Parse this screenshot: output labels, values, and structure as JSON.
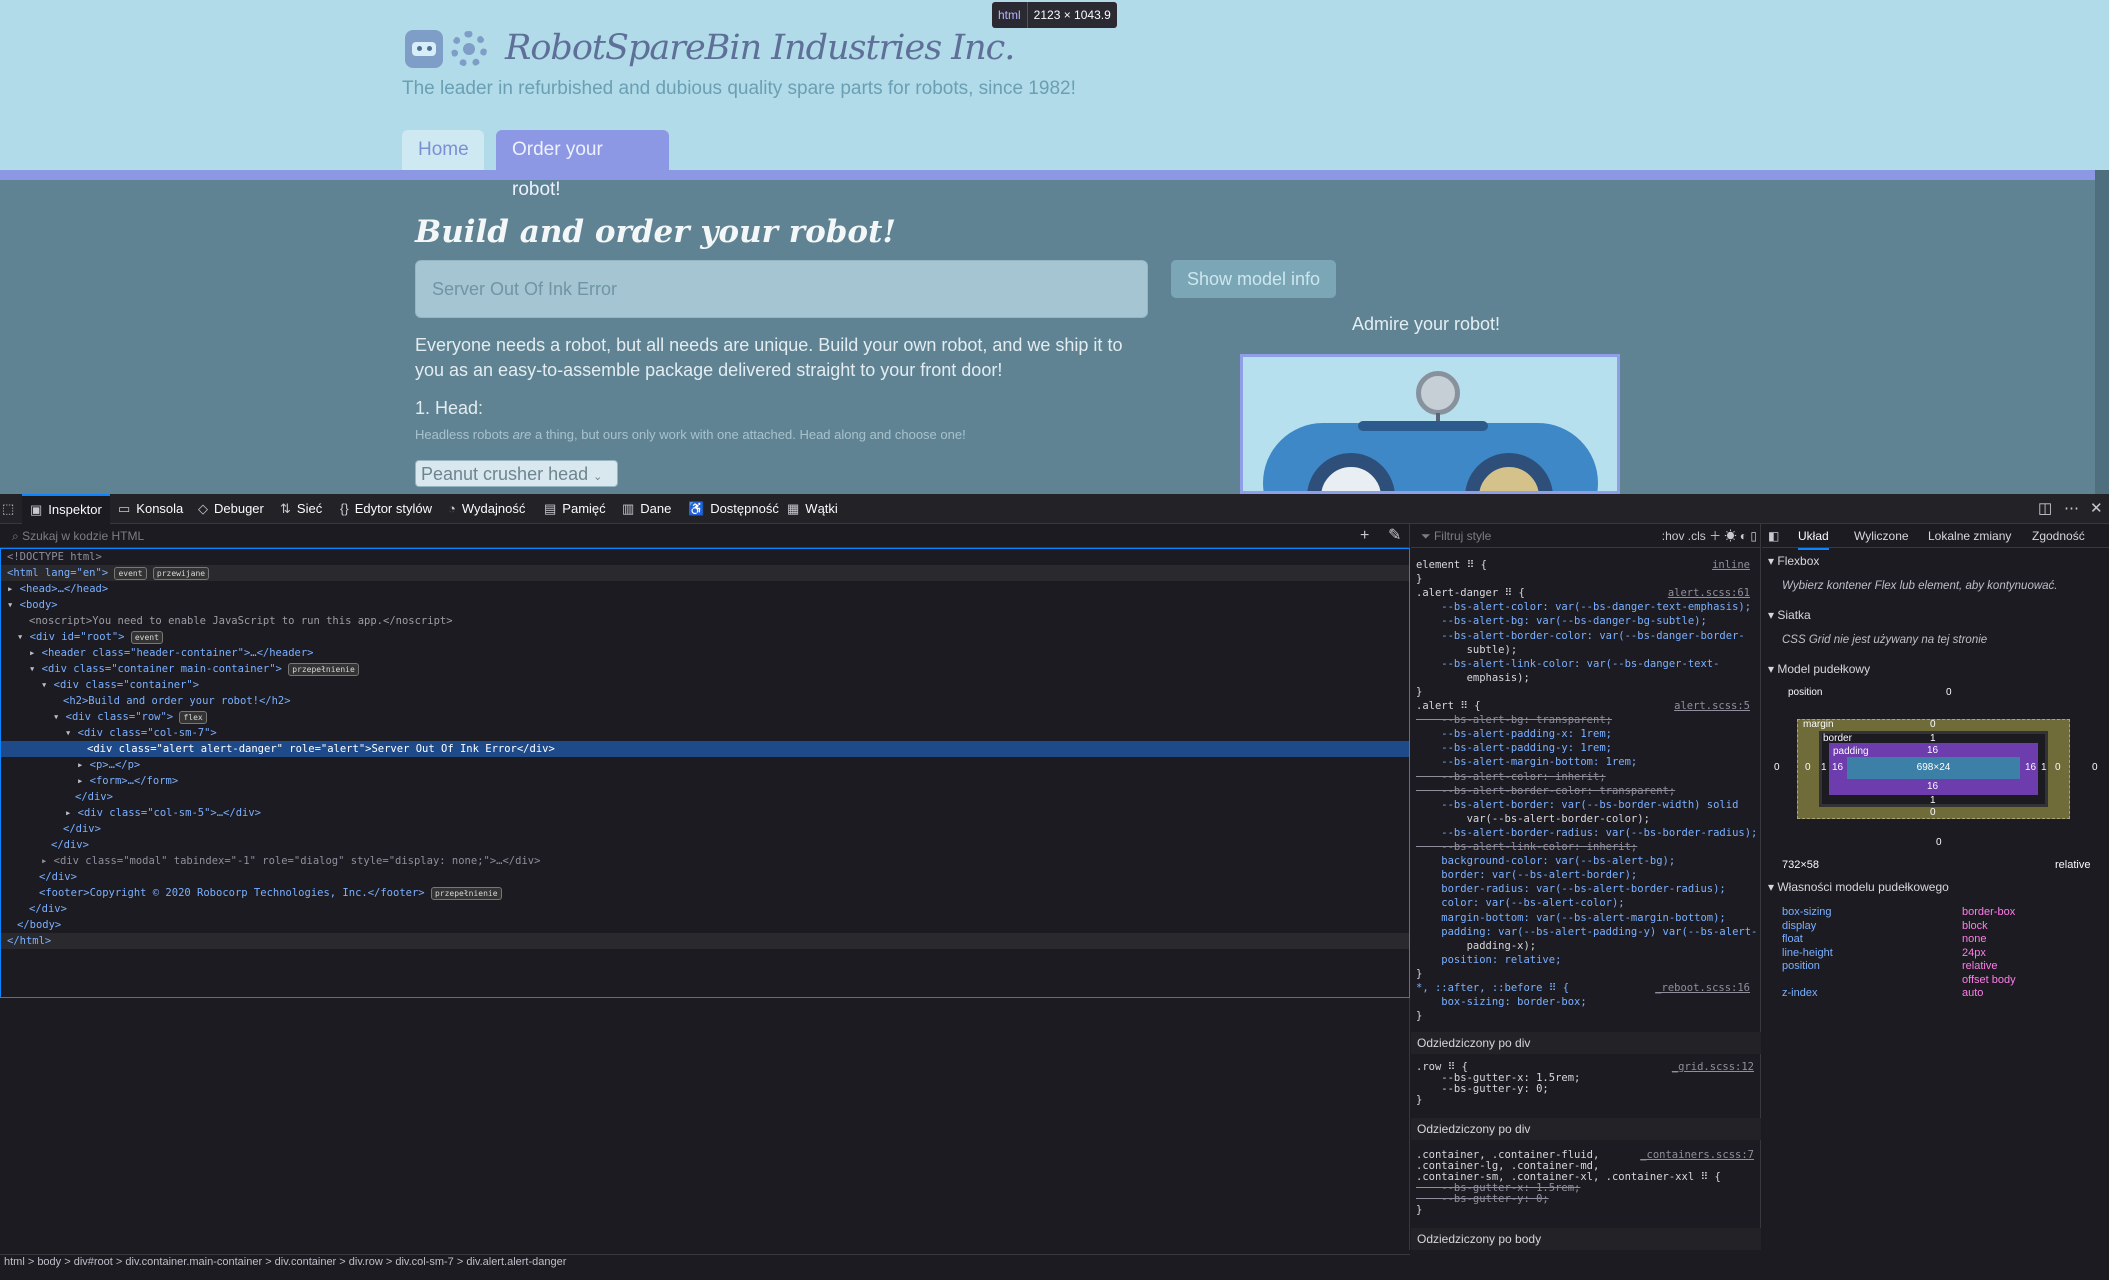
{
  "page": {
    "site_title": "RobotSpareBin Industries Inc.",
    "tagline": "The leader in refurbished and dubious quality spare parts for robots, since 1982!",
    "nav": [
      {
        "label": "Home"
      },
      {
        "label": "Order your robot!"
      }
    ],
    "main_title": "Build and order your robot!",
    "alert_text": "Server Out Of Ink Error",
    "show_model_label": "Show model info",
    "admire_text": "Admire your robot!",
    "intro_text": "Everyone needs a robot, but all needs are unique. Build your own robot, and we ship it to you as an easy-to-assemble package delivered straight to your front door!",
    "head_label": "1. Head:",
    "head_hint_a": "Headless robots ",
    "head_hint_em": "are",
    "head_hint_b": " a thing, but ours only work with one attached. Head along and choose one!",
    "head_select_value": "Peanut crusher head",
    "tooltip_tag": "html",
    "tooltip_size": "2123 × 1043.9"
  },
  "devtools": {
    "tabs": [
      "Inspektor",
      "Konsola",
      "Debuger",
      "Sieć",
      "Edytor stylów",
      "Wydajność",
      "Pamięć",
      "Dane",
      "Dostępność",
      "Wątki"
    ],
    "search_placeholder": "Szukaj w kodzie HTML",
    "tree": [
      "<!DOCTYPE html>",
      "<html lang=\"en\">",
      "<head>…</head>",
      "<body>",
      "<noscript>You need to enable JavaScript to run this app.</noscript>",
      "<div id=\"root\">",
      "<header class=\"header-container\">…</header>",
      "<div class=\"container main-container\">",
      "<div class=\"container\">",
      "<h2>Build and order your robot!</h2>",
      "<div class=\"row\">",
      "<div class=\"col-sm-7\">",
      "<div class=\"alert alert-danger\" role=\"alert\">Server Out Of Ink Error</div>",
      "<p>…</p>",
      "<form>…</form>",
      "</div>",
      "<div class=\"col-sm-5\">…</div>",
      "</div>",
      "</div>",
      "<div class=\"modal\" tabindex=\"-1\" role=\"dialog\" style=\"display: none;\">…</div>",
      "</div>",
      "<footer>Copyright © 2020 Robocorp Technologies, Inc.</footer>",
      "</div>",
      "</body>",
      "</html>"
    ],
    "badges": {
      "event": "event",
      "scroll": "przewijane",
      "flex": "flex",
      "overflow": "przepełnienie"
    },
    "styles_filter": "Filtruj style",
    "styles_tools": ":hov  .cls",
    "rules": [
      {
        "text": "element ⠿ {",
        "src": "inline"
      },
      {
        "text": "}",
        "src": ""
      },
      {
        "text": ".alert-danger ⠿ {",
        "src": "alert.scss:61"
      },
      {
        "text": "    --bs-alert-color: var(--bs-danger-text-emphasis);",
        "src": ""
      },
      {
        "text": "    --bs-alert-bg: var(--bs-danger-bg-subtle);",
        "src": ""
      },
      {
        "text": "    --bs-alert-border-color: var(--bs-danger-border-",
        "src": ""
      },
      {
        "text": "        subtle);",
        "src": ""
      },
      {
        "text": "    --bs-alert-link-color: var(--bs-danger-text-",
        "src": ""
      },
      {
        "text": "        emphasis);",
        "src": ""
      },
      {
        "text": "}",
        "src": ""
      },
      {
        "text": ".alert ⠿ {",
        "src": "alert.scss:5"
      },
      {
        "text": "    --bs-alert-bg: transparent;",
        "src": "",
        "strike": true
      },
      {
        "text": "    --bs-alert-padding-x: 1rem;",
        "src": ""
      },
      {
        "text": "    --bs-alert-padding-y: 1rem;",
        "src": ""
      },
      {
        "text": "    --bs-alert-margin-bottom: 1rem;",
        "src": ""
      },
      {
        "text": "    --bs-alert-color: inherit;",
        "src": "",
        "strike": true
      },
      {
        "text": "    --bs-alert-border-color: transparent;",
        "src": "",
        "strike": true
      },
      {
        "text": "    --bs-alert-border: var(--bs-border-width) solid",
        "src": ""
      },
      {
        "text": "        var(--bs-alert-border-color);",
        "src": ""
      },
      {
        "text": "    --bs-alert-border-radius: var(--bs-border-radius);",
        "src": ""
      },
      {
        "text": "    --bs-alert-link-color: inherit;",
        "src": "",
        "strike": true
      },
      {
        "text": "    background-color: var(--bs-alert-bg);",
        "src": ""
      },
      {
        "text": "    border: var(--bs-alert-border);",
        "src": ""
      },
      {
        "text": "    border-radius: var(--bs-alert-border-radius);",
        "src": ""
      },
      {
        "text": "    color: var(--bs-alert-color);",
        "src": ""
      },
      {
        "text": "    margin-bottom: var(--bs-alert-margin-bottom);",
        "src": ""
      },
      {
        "text": "    padding: var(--bs-alert-padding-y) var(--bs-alert-",
        "src": ""
      },
      {
        "text": "        padding-x);",
        "src": ""
      },
      {
        "text": "    position: relative;",
        "src": ""
      },
      {
        "text": "}",
        "src": ""
      },
      {
        "text": "*, ::after, ::before ⠿ {",
        "src": "_reboot.scss:16"
      },
      {
        "text": "    box-sizing: border-box;",
        "src": ""
      },
      {
        "text": "}",
        "src": ""
      }
    ],
    "inherited_1": "Odziedziczony po div",
    "row_rule": [
      ".row ⠿ {",
      "    --bs-gutter-x: 1.5rem;",
      "    --bs-gutter-y: 0;",
      "}"
    ],
    "row_src": "_grid.scss:12",
    "inherited_2": "Odziedziczony po div",
    "container_rule": [
      ".container, .container-fluid,",
      ".container-lg, .container-md,",
      ".container-sm, .container-xl, .container-xxl ⠿ {",
      "    --bs-gutter-x: 1.5rem;",
      "    --bs-gutter-y: 0;",
      "}"
    ],
    "container_src": "_containers.scss:7",
    "inherited_3": "Odziedziczony po body",
    "layout_tabs": [
      "Układ",
      "Wyliczone",
      "Lokalne zmiany",
      "Zgodność"
    ],
    "flexbox_title": "Flexbox",
    "flexbox_note": "Wybierz kontener Flex lub element, aby kontynuować.",
    "grid_title": "Siatka",
    "grid_note": "CSS Grid nie jest używany na tej stronie",
    "boxmodel_title": "Model pudełkowy",
    "box": {
      "position_label": "position",
      "position_val": "0",
      "margin": "margin",
      "border": "border",
      "padding": "padding",
      "margin_top": "0",
      "margin_bottom": "0",
      "margin_left": "0",
      "margin_right": "0",
      "border_top": "1",
      "border_bottom": "1",
      "border_left": "1",
      "border_right": "1",
      "padding_top": "16",
      "padding_bottom": "16",
      "padding_left": "16",
      "padding_right": "16",
      "content": "698×24",
      "outer_left": "0",
      "outer_right": "0",
      "pos_bottom": "0"
    },
    "element_size": "732×58",
    "element_position": "relative",
    "props_title": "Własności modelu pudełkowego",
    "props": [
      {
        "k": "box-sizing",
        "v": "border-box"
      },
      {
        "k": "display",
        "v": "block"
      },
      {
        "k": "float",
        "v": "none"
      },
      {
        "k": "line-height",
        "v": "24px"
      },
      {
        "k": "position",
        "v": "relative"
      },
      {
        "k": "",
        "v": "offset body"
      },
      {
        "k": "z-index",
        "v": "auto"
      }
    ],
    "status_text": "html > body > div#root > div.container.main-container > div.container > div.row > div.col-sm-7 > div.alert.alert-danger"
  }
}
